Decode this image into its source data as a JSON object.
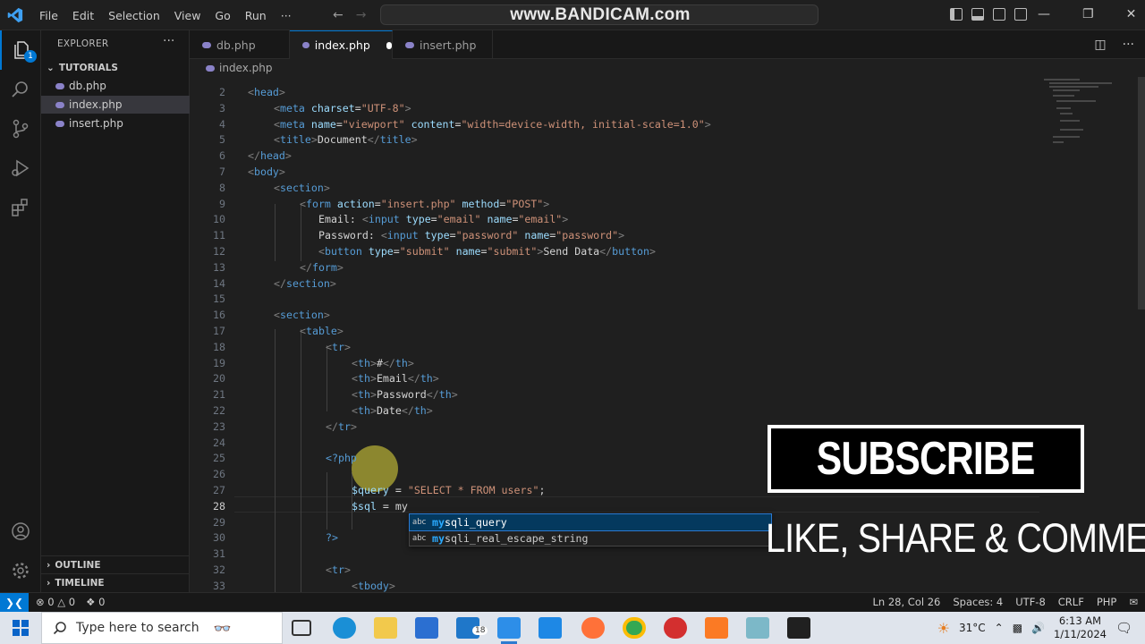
{
  "watermark": "www.BANDICAM.com",
  "menu": [
    "File",
    "Edit",
    "Selection",
    "View",
    "Go",
    "Run",
    "···"
  ],
  "activity_badge": "1",
  "sidebar": {
    "title": "EXPLORER",
    "folder": "TUTORIALS",
    "files": [
      "db.php",
      "index.php",
      "insert.php"
    ],
    "outline": "OUTLINE",
    "timeline": "TIMELINE"
  },
  "tabs": [
    "db.php",
    "index.php",
    "insert.php"
  ],
  "breadcrumb": "index.php",
  "code": [
    {
      "n": "2",
      "indent": 0,
      "html": "<span class='t-tag'>&lt;</span><span class='t-name'>head</span><span class='t-tag'>&gt;</span>"
    },
    {
      "n": "3",
      "indent": 1,
      "html": "<span class='t-tag'>&lt;</span><span class='t-name'>meta</span> <span class='t-attr'>charset</span><span class='t-text'>=</span><span class='t-str'>\"UTF-8\"</span><span class='t-tag'>&gt;</span>"
    },
    {
      "n": "4",
      "indent": 1,
      "html": "<span class='t-tag'>&lt;</span><span class='t-name'>meta</span> <span class='t-attr'>name</span><span class='t-text'>=</span><span class='t-str'>\"viewport\"</span> <span class='t-attr'>content</span><span class='t-text'>=</span><span class='t-str'>\"width=device-width, initial-scale=1.0\"</span><span class='t-tag'>&gt;</span>"
    },
    {
      "n": "5",
      "indent": 1,
      "html": "<span class='t-tag'>&lt;</span><span class='t-name'>title</span><span class='t-tag'>&gt;</span><span class='t-text'>Document</span><span class='t-tag'>&lt;/</span><span class='t-name'>title</span><span class='t-tag'>&gt;</span>"
    },
    {
      "n": "6",
      "indent": 0,
      "html": "<span class='t-tag'>&lt;/</span><span class='t-name'>head</span><span class='t-tag'>&gt;</span>"
    },
    {
      "n": "7",
      "indent": 0,
      "html": "<span class='t-tag'>&lt;</span><span class='t-name'>body</span><span class='t-tag'>&gt;</span>"
    },
    {
      "n": "8",
      "indent": 1,
      "html": "<span class='t-tag'>&lt;</span><span class='t-name'>section</span><span class='t-tag'>&gt;</span>"
    },
    {
      "n": "9",
      "indent": 2,
      "html": "<span class='t-tag'>&lt;</span><span class='t-name'>form</span> <span class='t-attr'>action</span><span class='t-text'>=</span><span class='t-str'>\"insert.php\"</span> <span class='t-attr'>method</span><span class='t-text'>=</span><span class='t-str'>\"POST\"</span><span class='t-tag'>&gt;</span>"
    },
    {
      "n": "10",
      "indent": 2,
      "pad": 3,
      "html": "<span class='t-text'>Email: </span><span class='t-tag'>&lt;</span><span class='t-name'>input</span> <span class='t-attr'>type</span><span class='t-text'>=</span><span class='t-str'>\"email\"</span> <span class='t-attr'>name</span><span class='t-text'>=</span><span class='t-str'>\"email\"</span><span class='t-tag'>&gt;</span>"
    },
    {
      "n": "11",
      "indent": 2,
      "pad": 3,
      "html": "<span class='t-text'>Password: </span><span class='t-tag'>&lt;</span><span class='t-name'>input</span> <span class='t-attr'>type</span><span class='t-text'>=</span><span class='t-str'>\"password\"</span> <span class='t-attr'>name</span><span class='t-text'>=</span><span class='t-str'>\"password\"</span><span class='t-tag'>&gt;</span>"
    },
    {
      "n": "12",
      "indent": 2,
      "pad": 3,
      "html": "<span class='t-tag'>&lt;</span><span class='t-name'>button</span> <span class='t-attr'>type</span><span class='t-text'>=</span><span class='t-str'>\"submit\"</span> <span class='t-attr'>name</span><span class='t-text'>=</span><span class='t-str'>\"submit\"</span><span class='t-tag'>&gt;</span><span class='t-text'>Send Data</span><span class='t-tag'>&lt;/</span><span class='t-name'>button</span><span class='t-tag'>&gt;</span>"
    },
    {
      "n": "13",
      "indent": 2,
      "html": "<span class='t-tag'>&lt;/</span><span class='t-name'>form</span><span class='t-tag'>&gt;</span>"
    },
    {
      "n": "14",
      "indent": 1,
      "html": "<span class='t-tag'>&lt;/</span><span class='t-name'>section</span><span class='t-tag'>&gt;</span>"
    },
    {
      "n": "15",
      "indent": 0,
      "html": ""
    },
    {
      "n": "16",
      "indent": 1,
      "html": "<span class='t-tag'>&lt;</span><span class='t-name'>section</span><span class='t-tag'>&gt;</span>"
    },
    {
      "n": "17",
      "indent": 2,
      "html": "<span class='t-tag'>&lt;</span><span class='t-name'>table</span><span class='t-tag'>&gt;</span>"
    },
    {
      "n": "18",
      "indent": 3,
      "html": "<span class='t-tag'>&lt;</span><span class='t-name'>tr</span><span class='t-tag'>&gt;</span>"
    },
    {
      "n": "19",
      "indent": 4,
      "html": "<span class='t-tag'>&lt;</span><span class='t-name'>th</span><span class='t-tag'>&gt;</span><span class='t-text'>#</span><span class='t-tag'>&lt;/</span><span class='t-name'>th</span><span class='t-tag'>&gt;</span>"
    },
    {
      "n": "20",
      "indent": 4,
      "html": "<span class='t-tag'>&lt;</span><span class='t-name'>th</span><span class='t-tag'>&gt;</span><span class='t-text'>Email</span><span class='t-tag'>&lt;/</span><span class='t-name'>th</span><span class='t-tag'>&gt;</span>"
    },
    {
      "n": "21",
      "indent": 4,
      "html": "<span class='t-tag'>&lt;</span><span class='t-name'>th</span><span class='t-tag'>&gt;</span><span class='t-text'>Password</span><span class='t-tag'>&lt;/</span><span class='t-name'>th</span><span class='t-tag'>&gt;</span>"
    },
    {
      "n": "22",
      "indent": 4,
      "html": "<span class='t-tag'>&lt;</span><span class='t-name'>th</span><span class='t-tag'>&gt;</span><span class='t-text'>Date</span><span class='t-tag'>&lt;/</span><span class='t-name'>th</span><span class='t-tag'>&gt;</span>"
    },
    {
      "n": "23",
      "indent": 3,
      "html": "<span class='t-tag'>&lt;/</span><span class='t-name'>tr</span><span class='t-tag'>&gt;</span>"
    },
    {
      "n": "24",
      "indent": 0,
      "html": ""
    },
    {
      "n": "25",
      "indent": 3,
      "html": "<span class='t-php'>&lt;?php</span>"
    },
    {
      "n": "26",
      "indent": 0,
      "html": ""
    },
    {
      "n": "27",
      "indent": 4,
      "html": "<span class='t-var'>$query</span><span class='t-text'> = </span><span class='t-str'>\"SELECT * FROM users\"</span><span class='t-text'>;</span>"
    },
    {
      "n": "28",
      "indent": 4,
      "current": true,
      "html": "<span class='t-var'>$sql</span><span class='t-text'> = my</span>"
    },
    {
      "n": "29",
      "indent": 0,
      "html": ""
    },
    {
      "n": "30",
      "indent": 3,
      "html": "<span class='t-php'>?&gt;</span>"
    },
    {
      "n": "31",
      "indent": 0,
      "html": ""
    },
    {
      "n": "32",
      "indent": 3,
      "html": "<span class='t-tag'>&lt;</span><span class='t-name'>tr</span><span class='t-tag'>&gt;</span>"
    },
    {
      "n": "33",
      "indent": 4,
      "html": "<span class='t-tag'>&lt;</span><span class='t-name'>tbody</span><span class='t-tag'>&gt;</span>"
    }
  ],
  "suggestions": [
    {
      "kind": "abc",
      "match": "my",
      "rest": "sqli_query",
      "selected": true
    },
    {
      "kind": "abc",
      "match": "my",
      "rest": "sqli_real_escape_string",
      "selected": false
    }
  ],
  "overlay": {
    "subscribe": "SUBSCRIBE",
    "cta": "LIKE, SHARE & COMMENT"
  },
  "status": {
    "errors": "0",
    "warnings": "0",
    "ports": "0",
    "position": "Ln 28, Col 26",
    "spaces": "Spaces: 4",
    "encoding": "UTF-8",
    "eol": "CRLF",
    "language": "PHP"
  },
  "taskbar": {
    "search_placeholder": "Type here to search",
    "teams_badge": "18",
    "weather": "31°C",
    "time": "6:13 AM",
    "date": "1/11/2024"
  },
  "colors": {
    "accent": "#0078d4",
    "editor_bg": "#1f1f1f",
    "sidebar_bg": "#181818"
  }
}
